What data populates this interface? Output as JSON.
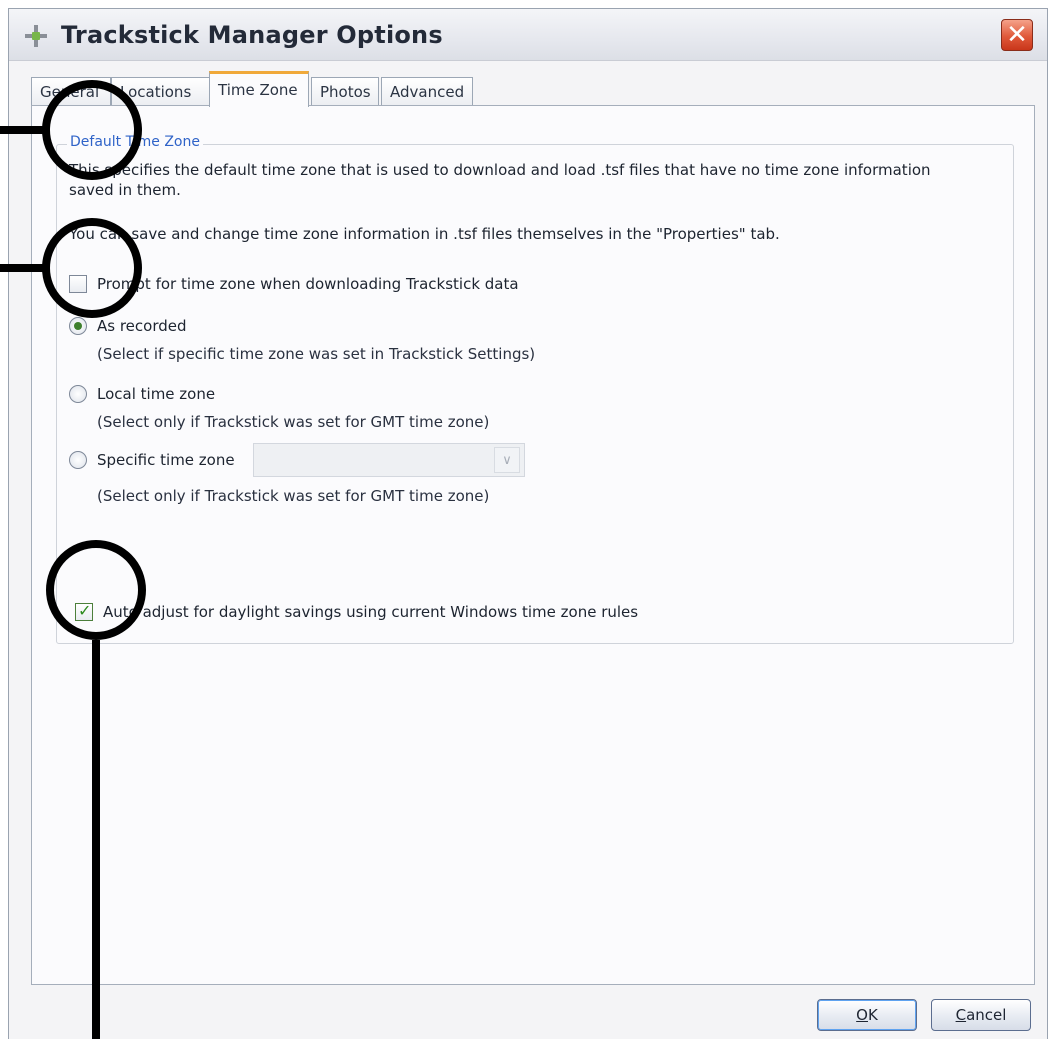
{
  "window": {
    "title": "Trackstick Manager Options",
    "close_glyph": "✕"
  },
  "tabs": [
    {
      "label": "General",
      "active": false
    },
    {
      "label": "Locations",
      "active": false
    },
    {
      "label": "Time Zone",
      "active": true
    },
    {
      "label": "Photos",
      "active": false
    },
    {
      "label": "Advanced",
      "active": false
    }
  ],
  "group": {
    "title": "Default Time Zone",
    "description_line1": "This specifies the default time zone that is used to download and load .tsf files that have no time zone information",
    "description_line2": "saved in them.",
    "note": "You can save and change time zone information in .tsf files themselves in the \"Properties\" tab.",
    "prompt_checkbox": {
      "label": "Prompt for time zone when downloading Trackstick data",
      "checked": false
    },
    "radios": [
      {
        "label": "As recorded",
        "hint": "(Select if specific time zone was set in Trackstick Settings)",
        "selected": true
      },
      {
        "label": "Local time zone",
        "hint": "(Select only if Trackstick was set for GMT time zone)",
        "selected": false
      },
      {
        "label": "Specific time zone",
        "hint": "(Select only if Trackstick was set for GMT time zone)",
        "selected": false
      }
    ],
    "specific_select_value": "",
    "dst_checkbox": {
      "label": "Auto adjust for daylight savings using current Windows time zone rules",
      "checked": true
    }
  },
  "buttons": {
    "ok_accel": "O",
    "ok_rest": "K",
    "cancel_accel": "C",
    "cancel_rest": "ancel"
  },
  "icons": {
    "app": "trackstick-crosshair-icon",
    "close": "close-icon",
    "check": "checkmark-icon",
    "dropdown": "chevron-down-icon"
  },
  "colors": {
    "group_title": "#2f63c8",
    "active_tab_accent": "#f0a93a",
    "close_button": "#e0593a",
    "annotation": "#000000"
  }
}
